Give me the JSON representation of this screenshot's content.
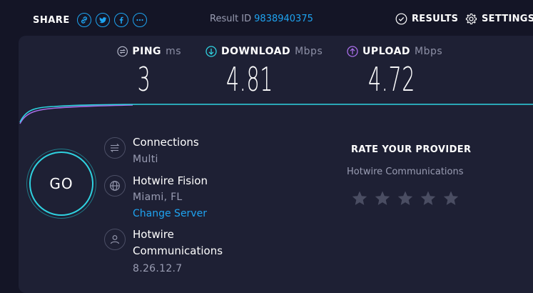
{
  "header": {
    "share_label": "SHARE",
    "result_label": "Result ID",
    "result_id": "9838940375",
    "results_label": "RESULTS",
    "settings_label": "SETTINGS"
  },
  "metrics": {
    "ping": {
      "label": "PING",
      "unit": "ms",
      "value": "3"
    },
    "download": {
      "label": "DOWNLOAD",
      "unit": "Mbps",
      "value": "4.81"
    },
    "upload": {
      "label": "UPLOAD",
      "unit": "Mbps",
      "value": "4.72"
    }
  },
  "go_label": "GO",
  "connections": {
    "title": "Connections",
    "value": "Multi"
  },
  "server": {
    "name": "Hotwire Fision",
    "location": "Miami, FL",
    "change_label": "Change Server"
  },
  "isp": {
    "name_line1": "Hotwire",
    "name_line2": "Communications",
    "ip": "8.26.12.7"
  },
  "rating": {
    "title": "RATE YOUR PROVIDER",
    "provider": "Hotwire Communications",
    "stars_total": 5,
    "stars_selected": 0
  },
  "colors": {
    "accent": "#1ea3f0",
    "download": "#2fd2e0",
    "upload": "#a86ee8",
    "background": "#141526",
    "panel": "#1e2034"
  },
  "icons": [
    "link-icon",
    "twitter-icon",
    "facebook-icon",
    "more-icon",
    "check-circle-icon",
    "gear-icon",
    "ping-icon",
    "download-icon",
    "upload-icon",
    "connections-icon",
    "globe-icon",
    "person-icon",
    "star-icon"
  ]
}
